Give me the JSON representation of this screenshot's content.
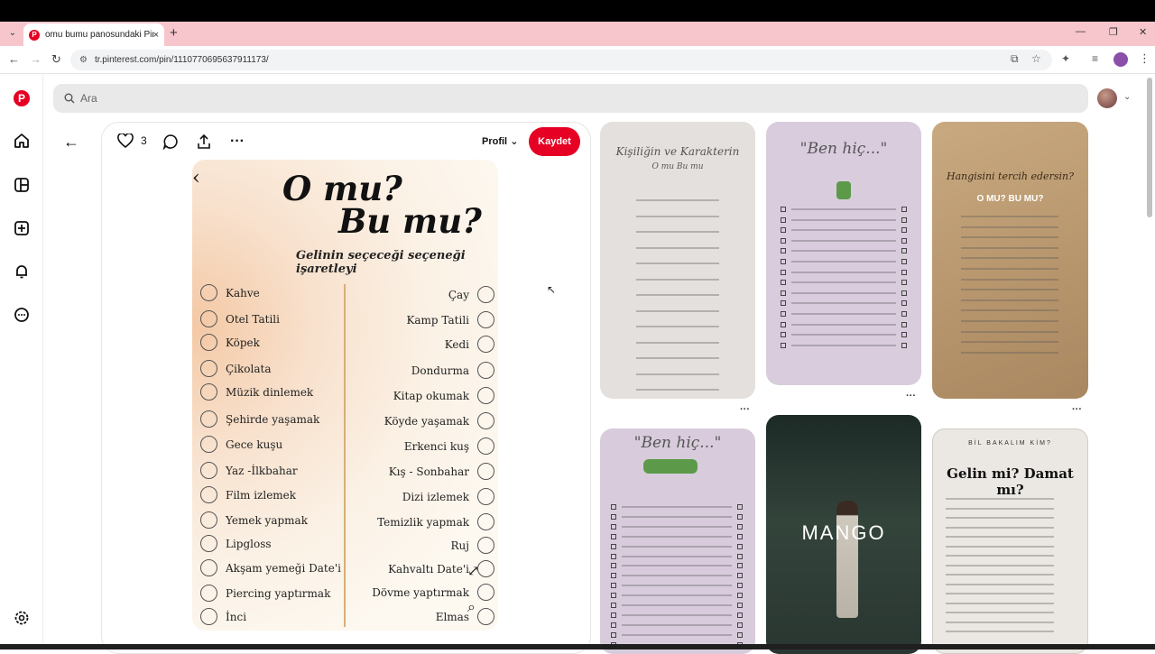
{
  "browser": {
    "tab_title": "omu bumu panosundaki Pin",
    "tab_close": "×",
    "new_tab": "+",
    "url": "tr.pinterest.com/pin/1110770695637911173/",
    "accent_color": "#f6c6cc"
  },
  "search": {
    "placeholder": "Ara"
  },
  "pin": {
    "like_count": "3",
    "profile_label": "Profil",
    "save_label": "Kaydet",
    "image": {
      "title_line1": "O mu?",
      "title_line2": "Bu mu?",
      "subtitle": "Gelinin seçeceği seçeneği işaretleyi",
      "left_items": [
        "Kahve",
        "Otel Tatili",
        "Köpek",
        "Çikolata",
        "Müzik dinlemek",
        "Şehirde yaşamak",
        "Gece kuşu",
        "Yaz -İlkbahar",
        "Film izlemek",
        "Yemek yapmak",
        "Lipgloss",
        "Akşam yemeği Date'i",
        "Piercing yaptırmak",
        "İnci"
      ],
      "right_items": [
        "Çay",
        "Kamp Tatili",
        "Kedi",
        "Dondurma",
        "Kitap okumak",
        "Köyde yaşamak",
        "Erkenci kuş",
        "Kış - Sonbahar",
        "Dizi izlemek",
        "Temizlik yapmak",
        "Ruj",
        "Kahvaltı Date'i",
        "Dövme yaptırmak",
        "Elmas"
      ]
    }
  },
  "grid": {
    "card1_title": "Kişiliğin ve Karakterin",
    "card1_subtitle": "O mu Bu mu",
    "card2_title": "\"Ben hiç...\"",
    "card3_title": "Hangisini tercih edersin?",
    "card3_subtitle": "O MU? BU MU?",
    "card4_title": "\"Ben hiç...\"",
    "card5_brand": "MANGO",
    "card6_overline": "BİL BAKALIM KİM?",
    "card6_title": "Gelin mi? Damat mı?",
    "more": "···"
  },
  "colors": {
    "brand_red": "#e60023"
  }
}
